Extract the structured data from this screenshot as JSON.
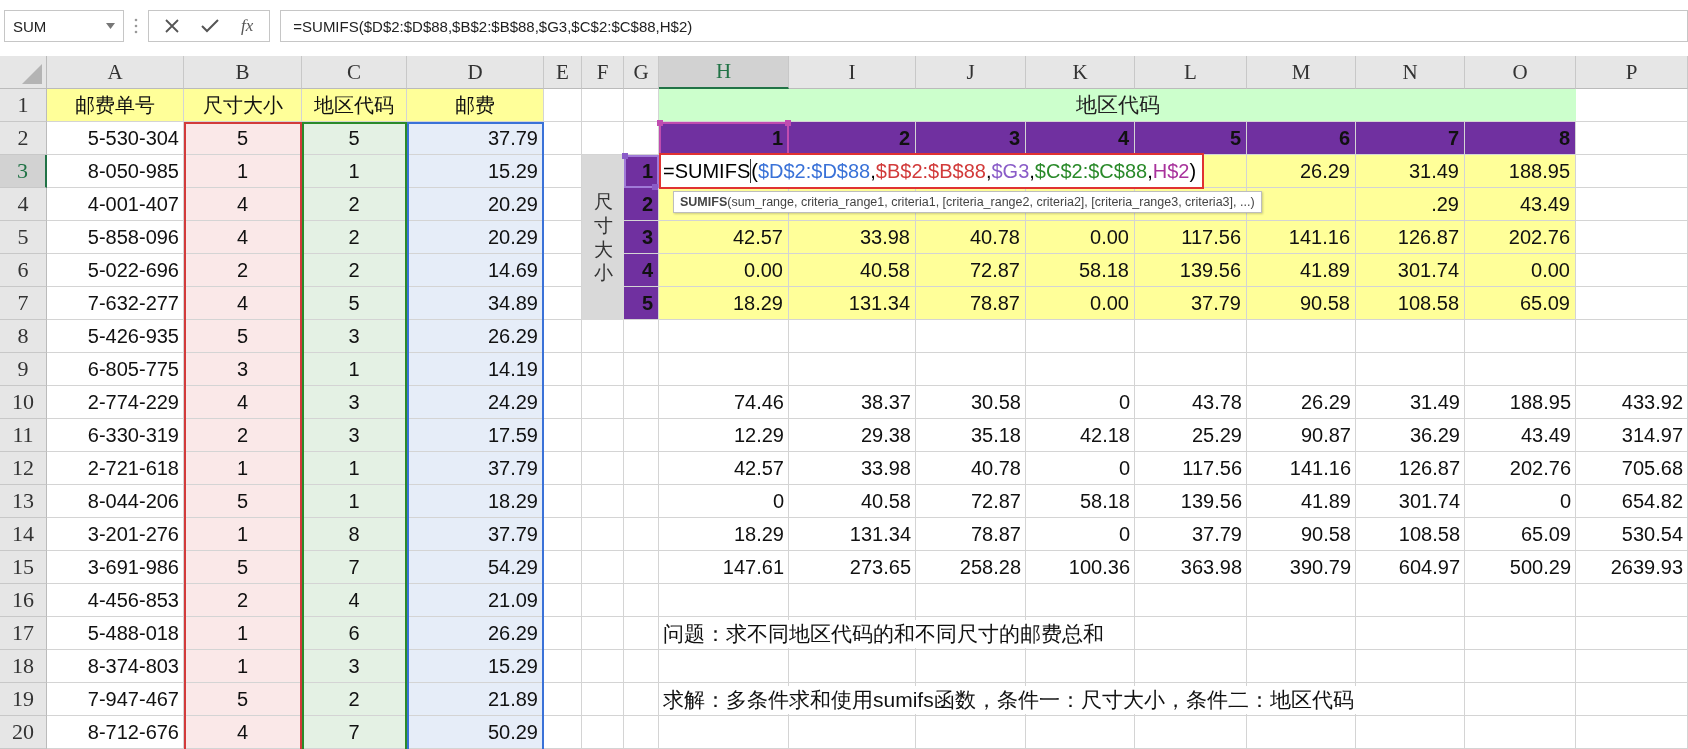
{
  "name_box": {
    "value": "SUM"
  },
  "formula_bar": {
    "function_label": "fx",
    "formula": "=SUMIFS($D$2:$D$88,$B$2:$B$88,$G3,$C$2:$C$88,H$2)"
  },
  "column_headers": [
    {
      "label": "A",
      "selected": false
    },
    {
      "label": "B",
      "selected": false
    },
    {
      "label": "C",
      "selected": false
    },
    {
      "label": "D",
      "selected": false
    },
    {
      "label": "E",
      "selected": false
    },
    {
      "label": "F",
      "selected": false
    },
    {
      "label": "G",
      "selected": false
    },
    {
      "label": "H",
      "selected": true
    },
    {
      "label": "I",
      "selected": false
    },
    {
      "label": "J",
      "selected": false
    },
    {
      "label": "K",
      "selected": false
    },
    {
      "label": "L",
      "selected": false
    },
    {
      "label": "M",
      "selected": false
    },
    {
      "label": "N",
      "selected": false
    },
    {
      "label": "O",
      "selected": false
    },
    {
      "label": "P",
      "selected": false
    }
  ],
  "row_headers": [
    {
      "label": "1",
      "selected": false
    },
    {
      "label": "2",
      "selected": false
    },
    {
      "label": "3",
      "selected": true
    },
    {
      "label": "4",
      "selected": false
    },
    {
      "label": "5",
      "selected": false
    },
    {
      "label": "6",
      "selected": false
    },
    {
      "label": "7",
      "selected": false
    },
    {
      "label": "8",
      "selected": false
    },
    {
      "label": "9",
      "selected": false
    },
    {
      "label": "10",
      "selected": false
    },
    {
      "label": "11",
      "selected": false
    },
    {
      "label": "12",
      "selected": false
    },
    {
      "label": "13",
      "selected": false
    },
    {
      "label": "14",
      "selected": false
    },
    {
      "label": "15",
      "selected": false
    },
    {
      "label": "16",
      "selected": false
    },
    {
      "label": "17",
      "selected": false
    },
    {
      "label": "18",
      "selected": false
    },
    {
      "label": "19",
      "selected": false
    },
    {
      "label": "20",
      "selected": false
    }
  ],
  "sheet": {
    "rows": [
      {
        "A": "邮费单号",
        "B": "尺寸大小",
        "C": "地区代码",
        "D": "邮费"
      },
      {
        "A": "5-530-304",
        "B": "5",
        "C": "5",
        "D": "37.79",
        "H": "1",
        "I": "2",
        "J": "3",
        "K": "4",
        "L": "5",
        "M": "6",
        "N": "7",
        "O": "8"
      },
      {
        "A": "8-050-985",
        "B": "1",
        "C": "1",
        "D": "15.29",
        "G": "1",
        "M": "26.29",
        "N": "31.49",
        "O": "188.95"
      },
      {
        "A": "4-001-407",
        "B": "4",
        "C": "2",
        "D": "20.29",
        "G": "2",
        "N": ".29",
        "O": "43.49"
      },
      {
        "A": "5-858-096",
        "B": "4",
        "C": "2",
        "D": "20.29",
        "G": "3",
        "H": "42.57",
        "I": "33.98",
        "J": "40.78",
        "K": "0.00",
        "L": "117.56",
        "M": "141.16",
        "N": "126.87",
        "O": "202.76"
      },
      {
        "A": "5-022-696",
        "B": "2",
        "C": "2",
        "D": "14.69",
        "G": "4",
        "H": "0.00",
        "I": "40.58",
        "J": "72.87",
        "K": "58.18",
        "L": "139.56",
        "M": "41.89",
        "N": "301.74",
        "O": "0.00"
      },
      {
        "A": "7-632-277",
        "B": "4",
        "C": "5",
        "D": "34.89",
        "G": "5",
        "H": "18.29",
        "I": "131.34",
        "J": "78.87",
        "K": "0.00",
        "L": "37.79",
        "M": "90.58",
        "N": "108.58",
        "O": "65.09"
      },
      {
        "A": "5-426-935",
        "B": "5",
        "C": "3",
        "D": "26.29"
      },
      {
        "A": "6-805-775",
        "B": "3",
        "C": "1",
        "D": "14.19"
      },
      {
        "A": "2-774-229",
        "B": "4",
        "C": "3",
        "D": "24.29",
        "H": "74.46",
        "I": "38.37",
        "J": "30.58",
        "K": "0",
        "L": "43.78",
        "M": "26.29",
        "N": "31.49",
        "O": "188.95",
        "P": "433.92"
      },
      {
        "A": "6-330-319",
        "B": "2",
        "C": "3",
        "D": "17.59",
        "H": "12.29",
        "I": "29.38",
        "J": "35.18",
        "K": "42.18",
        "L": "25.29",
        "M": "90.87",
        "N": "36.29",
        "O": "43.49",
        "P": "314.97"
      },
      {
        "A": "2-721-618",
        "B": "1",
        "C": "1",
        "D": "37.79",
        "H": "42.57",
        "I": "33.98",
        "J": "40.78",
        "K": "0",
        "L": "117.56",
        "M": "141.16",
        "N": "126.87",
        "O": "202.76",
        "P": "705.68"
      },
      {
        "A": "8-044-206",
        "B": "5",
        "C": "1",
        "D": "18.29",
        "H": "0",
        "I": "40.58",
        "J": "72.87",
        "K": "58.18",
        "L": "139.56",
        "M": "41.89",
        "N": "301.74",
        "O": "0",
        "P": "654.82"
      },
      {
        "A": "3-201-276",
        "B": "1",
        "C": "8",
        "D": "37.79",
        "H": "18.29",
        "I": "131.34",
        "J": "78.87",
        "K": "0",
        "L": "37.79",
        "M": "90.58",
        "N": "108.58",
        "O": "65.09",
        "P": "530.54"
      },
      {
        "A": "3-691-986",
        "B": "5",
        "C": "7",
        "D": "54.29",
        "H": "147.61",
        "I": "273.65",
        "J": "258.28",
        "K": "100.36",
        "L": "363.98",
        "M": "390.79",
        "N": "604.97",
        "O": "500.29",
        "P": "2639.93"
      },
      {
        "A": "4-456-853",
        "B": "2",
        "C": "4",
        "D": "21.09"
      },
      {
        "A": "5-488-018",
        "B": "1",
        "C": "6",
        "D": "26.29"
      },
      {
        "A": "8-374-803",
        "B": "1",
        "C": "3",
        "D": "15.29"
      },
      {
        "A": "7-947-467",
        "B": "5",
        "C": "2",
        "D": "21.89"
      },
      {
        "A": "8-712-676",
        "B": "4",
        "C": "7",
        "D": "50.29"
      }
    ]
  },
  "summary_grid": {
    "title": "地区代码",
    "side_label": "尺寸大小"
  },
  "cell_editor": {
    "parts": [
      {
        "text": "=SUMIFS"
      },
      {
        "text": "("
      },
      {
        "text": "$D$2:$D$88",
        "color": "#3a72d8"
      },
      {
        "text": ","
      },
      {
        "text": "$B$2:$B$88",
        "color": "#d23a3a"
      },
      {
        "text": ","
      },
      {
        "text": "$G3",
        "color": "#8a5cc8"
      },
      {
        "text": ","
      },
      {
        "text": "$C$2:$C$88",
        "color": "#2a8a2a"
      },
      {
        "text": ","
      },
      {
        "text": "H$2",
        "color": "#a8329c"
      },
      {
        "text": ")"
      }
    ],
    "tooltip": "**SUMIFS**(sum_range, criteria_range1, criteria1, [criteria_range2, criteria2], [criteria_range3, criteria3], ...)"
  },
  "notes": [
    "问题：求不同地区代码的和不同尺寸的邮费总和",
    "求解：多条件求和使用sumifs函数，条件一：尺寸大小，条件二：地区代码"
  ]
}
